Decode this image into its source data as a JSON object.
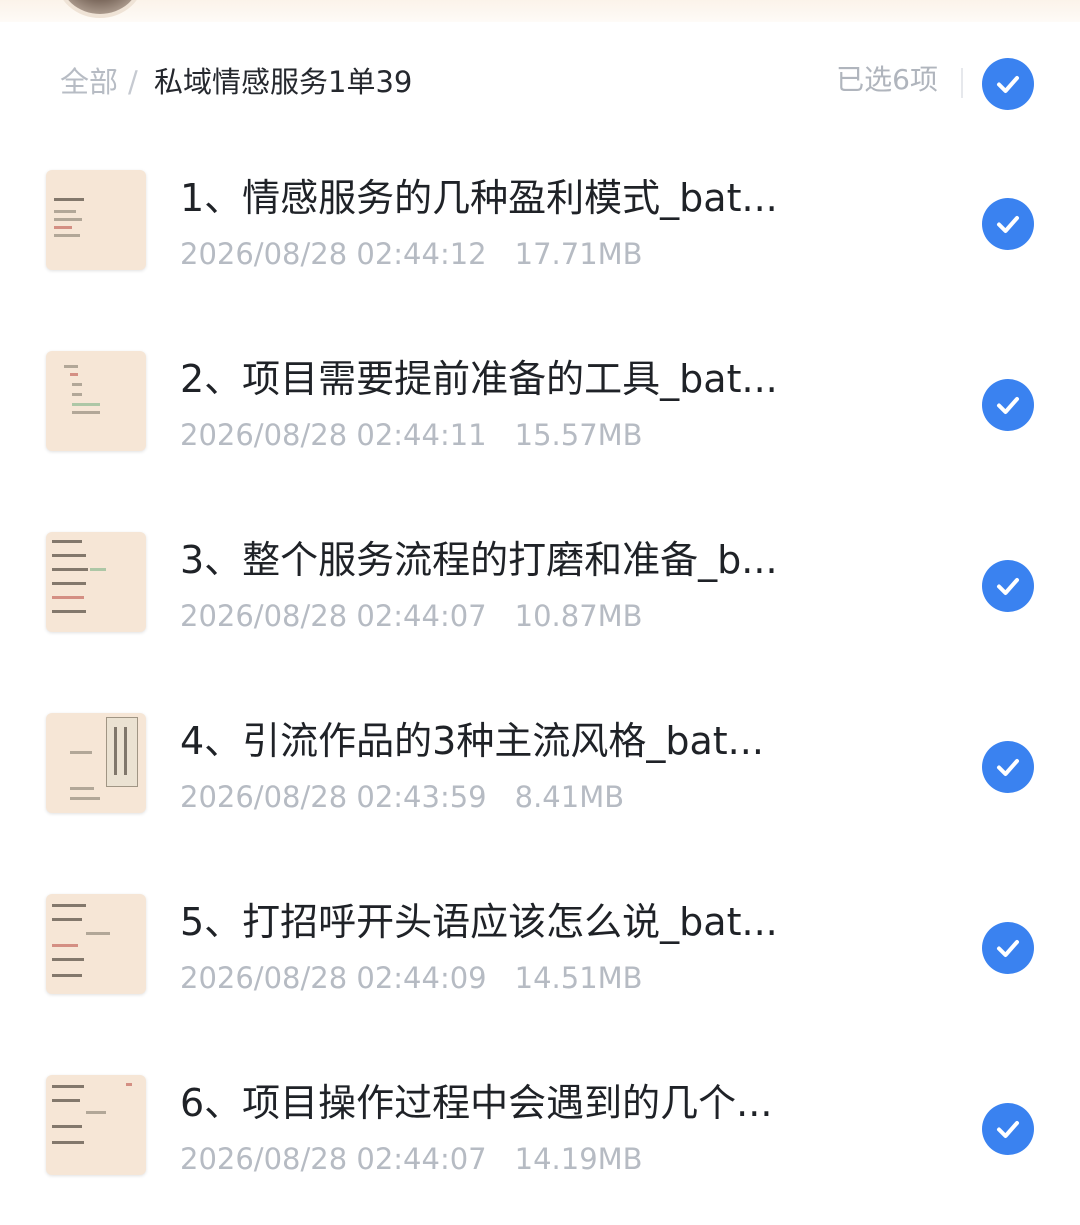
{
  "breadcrumb": {
    "root": "全部",
    "separator": "/",
    "current": "私域情感服务1单39"
  },
  "selection": {
    "count_label": "已选6项",
    "all_selected": true
  },
  "colors": {
    "accent": "#3a82f0",
    "title_text": "#1f2227",
    "meta_text": "#b6bbc3",
    "thumb_bg": "#f6e6d6"
  },
  "icons": {
    "checkbox": "check-circle-icon",
    "thumbnail": "mindmap-thumbnail"
  },
  "files": [
    {
      "name": "1、情感服务的几种盈利模式_bat...",
      "date": "2026/08/28 02:44:12",
      "size": "17.71MB",
      "selected": true
    },
    {
      "name": "2、项目需要提前准备的工具_bat...",
      "date": "2026/08/28 02:44:11",
      "size": "15.57MB",
      "selected": true
    },
    {
      "name": "3、整个服务流程的打磨和准备_b...",
      "date": "2026/08/28 02:44:07",
      "size": "10.87MB",
      "selected": true
    },
    {
      "name": "4、引流作品的3种主流风格_bat...",
      "date": "2026/08/28 02:43:59",
      "size": "8.41MB",
      "selected": true
    },
    {
      "name": "5、打招呼开头语应该怎么说_bat...",
      "date": "2026/08/28 02:44:09",
      "size": "14.51MB",
      "selected": true
    },
    {
      "name": "6、项目操作过程中会遇到的几个...",
      "date": "2026/08/28 02:44:07",
      "size": "14.19MB",
      "selected": true
    }
  ]
}
